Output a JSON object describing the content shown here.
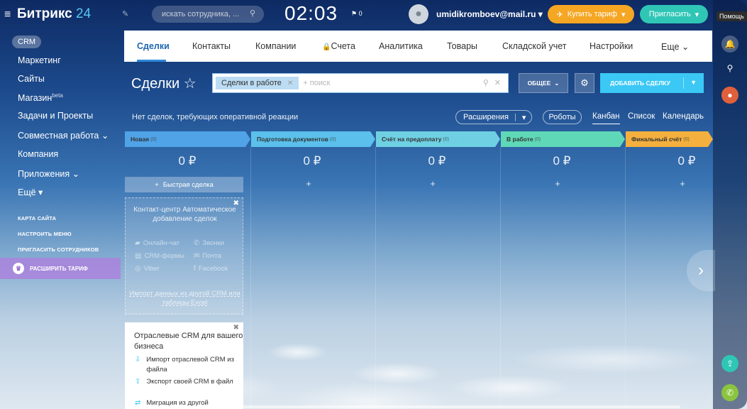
{
  "header": {
    "app_name": "Битрикс",
    "app_num": "24",
    "search_placeholder": "искать сотрудника, ...",
    "clock": "02:03",
    "flag_count": "0",
    "user_email": "umidikromboev@mail.ru",
    "buy_label": "Купить тариф",
    "invite_label": "Пригласить"
  },
  "sidebar": {
    "crm": "CRM",
    "items": [
      {
        "label": "Маркетинг"
      },
      {
        "label": "Сайты"
      },
      {
        "label": "Магазин",
        "sup": "beta"
      },
      {
        "label": "Задачи и Проекты"
      },
      {
        "label": "Совместная работа"
      },
      {
        "label": "Компания"
      },
      {
        "label": "Приложения"
      },
      {
        "label": "Ещё"
      }
    ],
    "links": [
      "КАРТА САЙТА",
      "НАСТРОИТЬ МЕНЮ",
      "ПРИГЛАСИТЬ СОТРУДНИКОВ"
    ],
    "upgrade": "РАСШИРИТЬ ТАРИФ"
  },
  "right_panel": {
    "help": "Помощь",
    "icons": [
      "bell-icon",
      "search-icon",
      "user-avatar",
      "transfer-icon",
      "phone-icon"
    ]
  },
  "tabs": [
    {
      "label": "Сделки",
      "active": true
    },
    {
      "label": "Контакты"
    },
    {
      "label": "Компании"
    },
    {
      "label": "Счета",
      "locked": true
    },
    {
      "label": "Аналитика"
    },
    {
      "label": "Товары"
    },
    {
      "label": "Складской учет"
    },
    {
      "label": "Настройки"
    },
    {
      "label": "Еще"
    }
  ],
  "toolbar": {
    "title": "Сделки",
    "filter_chip": "Сделки в работе",
    "filter_placeholder": "+ поиск",
    "general_label": "ОБЩЕЕ",
    "add_label": "ДОБАВИТЬ СДЕЛКУ"
  },
  "info": {
    "no_deals": "Нет сделок, требующих оперативной реакции",
    "extensions": "Расширения",
    "robots": "Роботы",
    "views": [
      "Канбан",
      "Список",
      "Календарь"
    ]
  },
  "stages": [
    {
      "name": "Новая",
      "count": "(0)",
      "sum": "0 ₽",
      "color": "#4fa3e6"
    },
    {
      "name": "Подготовка документов",
      "count": "(0)",
      "sum": "0 ₽",
      "color": "#5bc0eb"
    },
    {
      "name": "Счёт на предоплату",
      "count": "(0)",
      "sum": "0 ₽",
      "color": "#6fd0e3"
    },
    {
      "name": "В работе",
      "count": "(0)",
      "sum": "0 ₽",
      "color": "#5fd8b7"
    },
    {
      "name": "Финальный счёт",
      "count": "(0)",
      "sum": "0 ₽",
      "color": "#f4b03e"
    }
  ],
  "quick_deal": "Быстрая сделка",
  "contact_center": {
    "title": "Контакт-центр Автоматическое добавление сделок",
    "channels": [
      "Онлайн-чат",
      "Звонки",
      "CRM-формы",
      "Почта",
      "Viber",
      "Facebook"
    ],
    "import": "Импорт данных из другой CRM или таблицы Excel"
  },
  "industry": {
    "title": "Отраслевые CRM для вашего бизнеса",
    "items": [
      "Импорт отраслевой CRM из файла",
      "Экспорт своей CRM в файл",
      "Миграция из другой"
    ]
  }
}
